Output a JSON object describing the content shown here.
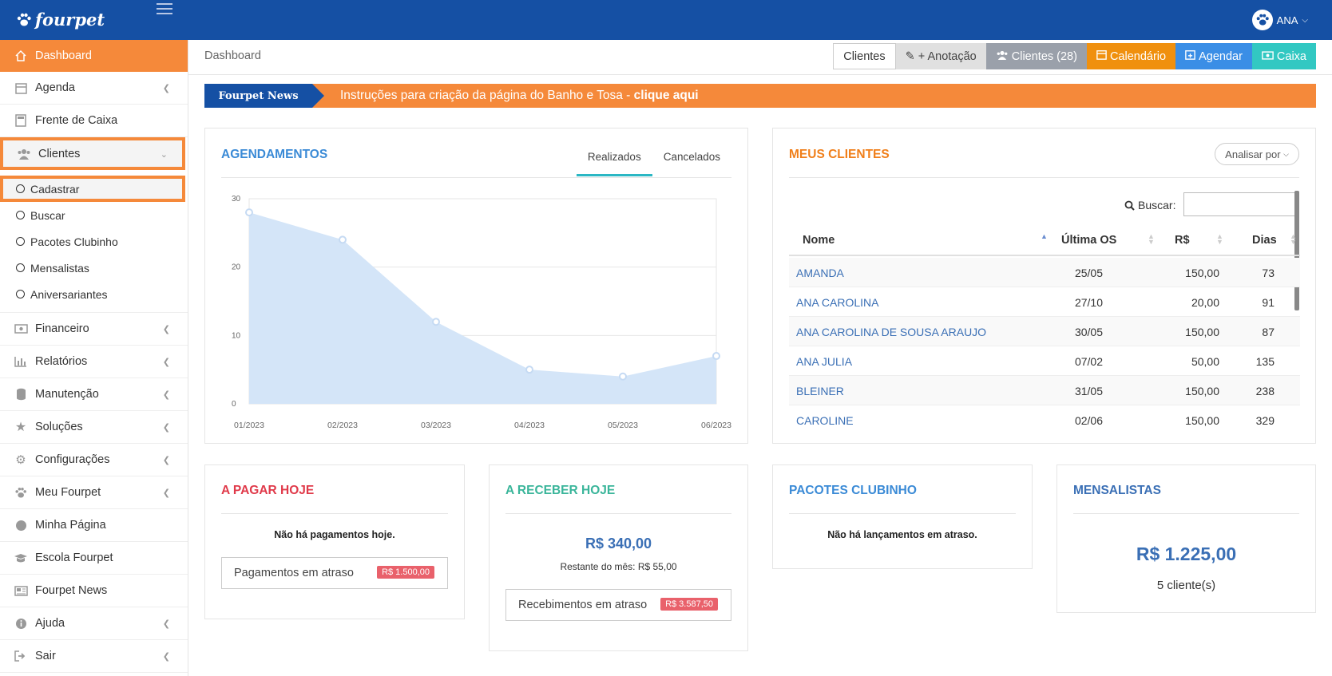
{
  "app": {
    "logo_text": "fourpet",
    "user_name": "ANA"
  },
  "colors": {
    "primary": "#1550a4",
    "accent": "#f5893a",
    "link": "#3a6fb5"
  },
  "sidebar": {
    "items": [
      {
        "label": "Dashboard",
        "icon": "home-icon"
      },
      {
        "label": "Agenda",
        "icon": "calendar-icon"
      },
      {
        "label": "Frente de Caixa",
        "icon": "calculator-icon"
      },
      {
        "label": "Clientes",
        "icon": "users-icon"
      },
      {
        "label": "Financeiro",
        "icon": "money-icon"
      },
      {
        "label": "Relatórios",
        "icon": "bar-chart-icon"
      },
      {
        "label": "Manutenção",
        "icon": "database-icon"
      },
      {
        "label": "Soluções",
        "icon": "star-icon"
      },
      {
        "label": "Configurações",
        "icon": "gears-icon"
      },
      {
        "label": "Meu Fourpet",
        "icon": "paw-icon"
      },
      {
        "label": "Minha Página",
        "icon": "globe-icon"
      },
      {
        "label": "Escola Fourpet",
        "icon": "graduation-cap-icon"
      },
      {
        "label": "Fourpet News",
        "icon": "newspaper-icon"
      },
      {
        "label": "Ajuda",
        "icon": "info-icon"
      },
      {
        "label": "Sair",
        "icon": "sign-out-icon"
      }
    ],
    "sub_items": [
      "Cadastrar",
      "Buscar",
      "Pacotes Clubinho",
      "Mensalistas",
      "Aniversariantes"
    ]
  },
  "header": {
    "breadcrumb": "Dashboard",
    "buttons": {
      "clientes": "Clientes",
      "anotacao": "+ Anotação",
      "clientes_count": "Clientes (28)",
      "calendario": "Calendário",
      "agendar": "Agendar",
      "caixa": "Caixa"
    }
  },
  "news": {
    "tag": "Fourpet News",
    "text": "Instruções para criação da página do Banho e Tosa - ",
    "link": "clique aqui"
  },
  "agendamentos": {
    "title": "AGENDAMENTOS",
    "tabs": [
      "Realizados",
      "Cancelados"
    ]
  },
  "chart_data": {
    "type": "area",
    "categories": [
      "01/2023",
      "02/2023",
      "03/2023",
      "04/2023",
      "05/2023",
      "06/2023"
    ],
    "values": [
      28,
      24,
      12,
      5,
      4,
      7
    ],
    "yticks": [
      0,
      10,
      20,
      30
    ],
    "ylim": [
      0,
      30
    ],
    "grid": true,
    "color": "#d4e5f8"
  },
  "meus_clientes": {
    "title": "MEUS CLIENTES",
    "analisar": "Analisar por",
    "search_label": "Buscar:",
    "search_value": "",
    "columns": [
      "Nome",
      "Última OS",
      "R$",
      "Dias"
    ],
    "rows": [
      {
        "nome": "AMANDA",
        "os": "25/05",
        "rs": "150,00",
        "dias": "73"
      },
      {
        "nome": "ANA CAROLINA",
        "os": "27/10",
        "rs": "20,00",
        "dias": "91"
      },
      {
        "nome": "ANA CAROLINA DE SOUSA ARAUJO",
        "os": "30/05",
        "rs": "150,00",
        "dias": "87"
      },
      {
        "nome": "ANA JULIA",
        "os": "07/02",
        "rs": "50,00",
        "dias": "135"
      },
      {
        "nome": "BLEINER",
        "os": "31/05",
        "rs": "150,00",
        "dias": "238"
      },
      {
        "nome": "CAROLINE",
        "os": "02/06",
        "rs": "150,00",
        "dias": "329"
      }
    ]
  },
  "a_pagar": {
    "title": "A PAGAR HOJE",
    "empty": "Não há pagamentos hoje.",
    "atraso_label": "Pagamentos em atraso",
    "atraso_value": "R$ 1.500,00"
  },
  "a_receber": {
    "title": "A RECEBER HOJE",
    "value": "R$ 340,00",
    "restante": "Restante do mês: R$ 55,00",
    "atraso_label": "Recebimentos em atraso",
    "atraso_value": "R$ 3.587,50"
  },
  "pacotes": {
    "title": "PACOTES CLUBINHO",
    "empty": "Não há lançamentos em atraso."
  },
  "mensalistas": {
    "title": "MENSALISTAS",
    "value": "R$ 1.225,00",
    "count": "5 cliente(s)"
  }
}
